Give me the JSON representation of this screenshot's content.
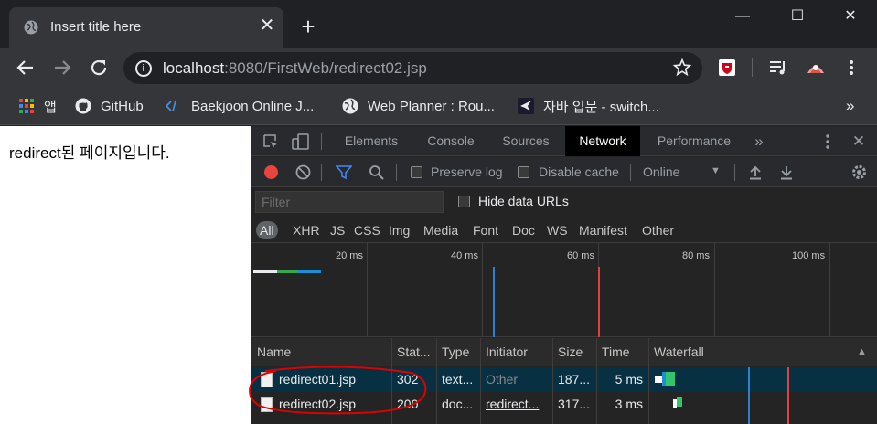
{
  "tab": {
    "title": "Insert title here",
    "close": "✕"
  },
  "new_tab": "+",
  "window_controls": {
    "minimize": "—",
    "maximize": "☐",
    "close": "✕"
  },
  "omnibox": {
    "host": "localhost",
    "rest": ":8080/FirstWeb/redirect02.jsp"
  },
  "bookmarks": [
    {
      "label": "앱",
      "icon": "apps-grid-icon"
    },
    {
      "label": "GitHub",
      "icon": "github-icon"
    },
    {
      "label": "Baekjoon Online J...",
      "icon": "code-icon"
    },
    {
      "label": "Web Planner : Rou...",
      "icon": "globe-icon"
    },
    {
      "label": "자바 입문 - switch...",
      "icon": "bird-icon"
    }
  ],
  "bookmarks_more": "»",
  "page": {
    "text": "redirect된 페이지입니다."
  },
  "devtools": {
    "tabs": [
      "Elements",
      "Console",
      "Sources",
      "Network",
      "Performance"
    ],
    "active_tab": "Network",
    "more_tabs": "»",
    "close": "✕",
    "preserve_log": "Preserve log",
    "disable_cache": "Disable cache",
    "throttle": "Online",
    "filter_placeholder": "Filter",
    "hide_data_urls": "Hide data URLs",
    "types": [
      "All",
      "XHR",
      "JS",
      "CSS",
      "Img",
      "Media",
      "Font",
      "Doc",
      "WS",
      "Manifest",
      "Other"
    ],
    "overview_ticks": [
      "20 ms",
      "40 ms",
      "60 ms",
      "80 ms",
      "100 ms"
    ],
    "columns": [
      "Name",
      "Stat...",
      "Type",
      "Initiator",
      "Size",
      "Time",
      "Waterfall"
    ],
    "sort_indicator": "▲",
    "requests": [
      {
        "name": "redirect01.jsp",
        "status": "302",
        "type": "text...",
        "initiator": "Other",
        "size": "187...",
        "time": "5 ms"
      },
      {
        "name": "redirect02.jsp",
        "status": "200",
        "type": "doc...",
        "initiator": "redirect...",
        "size": "317...",
        "time": "3 ms"
      }
    ]
  },
  "colors": {
    "record": "#e8453c",
    "filter_icon": "#4285f4",
    "selected_row": "#073042",
    "annotation": "#e00000",
    "dom_line": "#2d7fd3",
    "load_line": "#e04040"
  }
}
